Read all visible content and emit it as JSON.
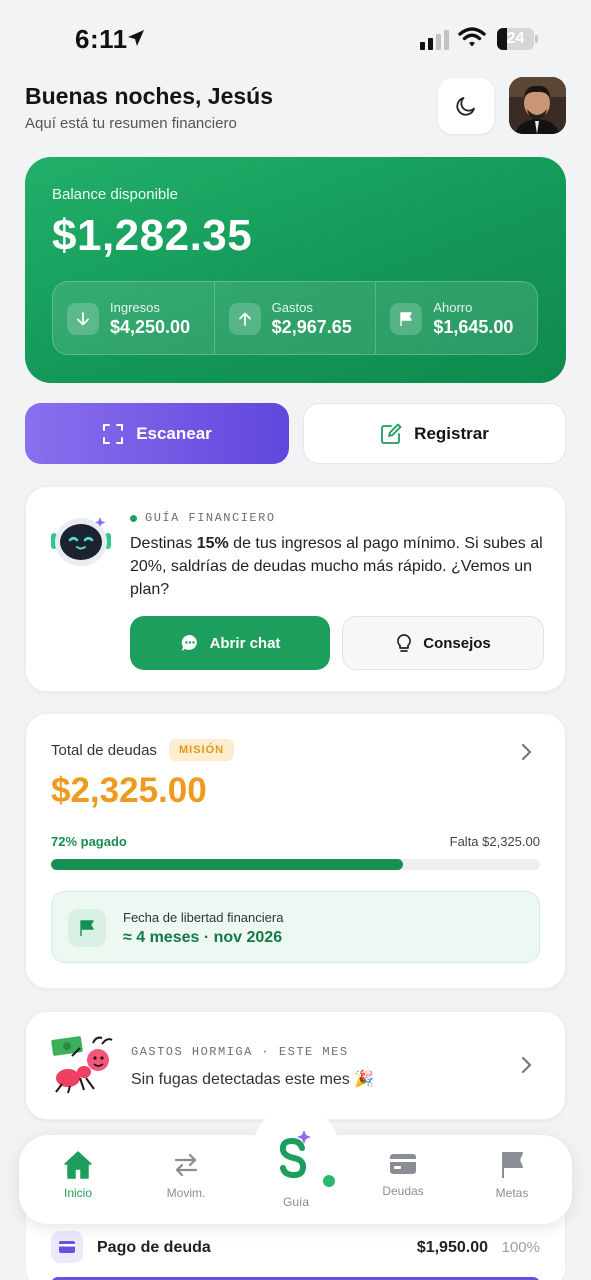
{
  "status_bar": {
    "time": "6:11",
    "battery": "24"
  },
  "header": {
    "greeting": "Buenas noches, Jesús",
    "subtitle": "Aquí está tu resumen financiero"
  },
  "balance": {
    "label": "Balance disponible",
    "amount": "$1,282.35",
    "stats": [
      {
        "label": "Ingresos",
        "value": "$4,250.00",
        "icon": "arrow-down-icon"
      },
      {
        "label": "Gastos",
        "value": "$2,967.65",
        "icon": "arrow-up-icon"
      },
      {
        "label": "Ahorro",
        "value": "$1,645.00",
        "icon": "flag-icon"
      }
    ]
  },
  "actions": {
    "scan_label": "Escanear",
    "register_label": "Registrar"
  },
  "guide": {
    "tag": "GUÍA FINANCIERO",
    "msg_before": "Destinas ",
    "msg_bold": "15%",
    "msg_after": " de tus ingresos al pago mínimo. Si subes al 20%, saldrías de deudas mucho más rápido. ¿Vemos un plan?",
    "chat_label": "Abrir chat",
    "tips_label": "Consejos"
  },
  "debt": {
    "title": "Total de deudas",
    "badge": "MISIÓN",
    "amount": "$2,325.00",
    "paid_label": "72% pagado",
    "remaining_label": "Falta $2,325.00",
    "progress": 0.72,
    "freedom_label": "Fecha de libertad financiera",
    "freedom_value": "≈ 4 meses · nov 2026"
  },
  "ant_expenses": {
    "tag": "GASTOS HORMIGA · ESTE MES",
    "message": "Sin fugas detectadas este mes 🎉"
  },
  "peek_row": {
    "label": "Pago de deuda",
    "value": "$1,950.00",
    "percent": "100%"
  },
  "nav": {
    "items": [
      {
        "label": "Inicio",
        "icon": "home-icon",
        "active": true
      },
      {
        "label": "Movim.",
        "icon": "transfer-icon",
        "active": false
      },
      {
        "label": "Guía",
        "icon": "guide-logo-icon",
        "active": false
      },
      {
        "label": "Deudas",
        "icon": "card-icon",
        "active": false
      },
      {
        "label": "Metas",
        "icon": "flag-icon",
        "active": false
      }
    ]
  },
  "colors": {
    "primary_green": "#1d9e5c",
    "accent_purple": "#6d4fe0",
    "debt_orange": "#ef9a1c"
  }
}
